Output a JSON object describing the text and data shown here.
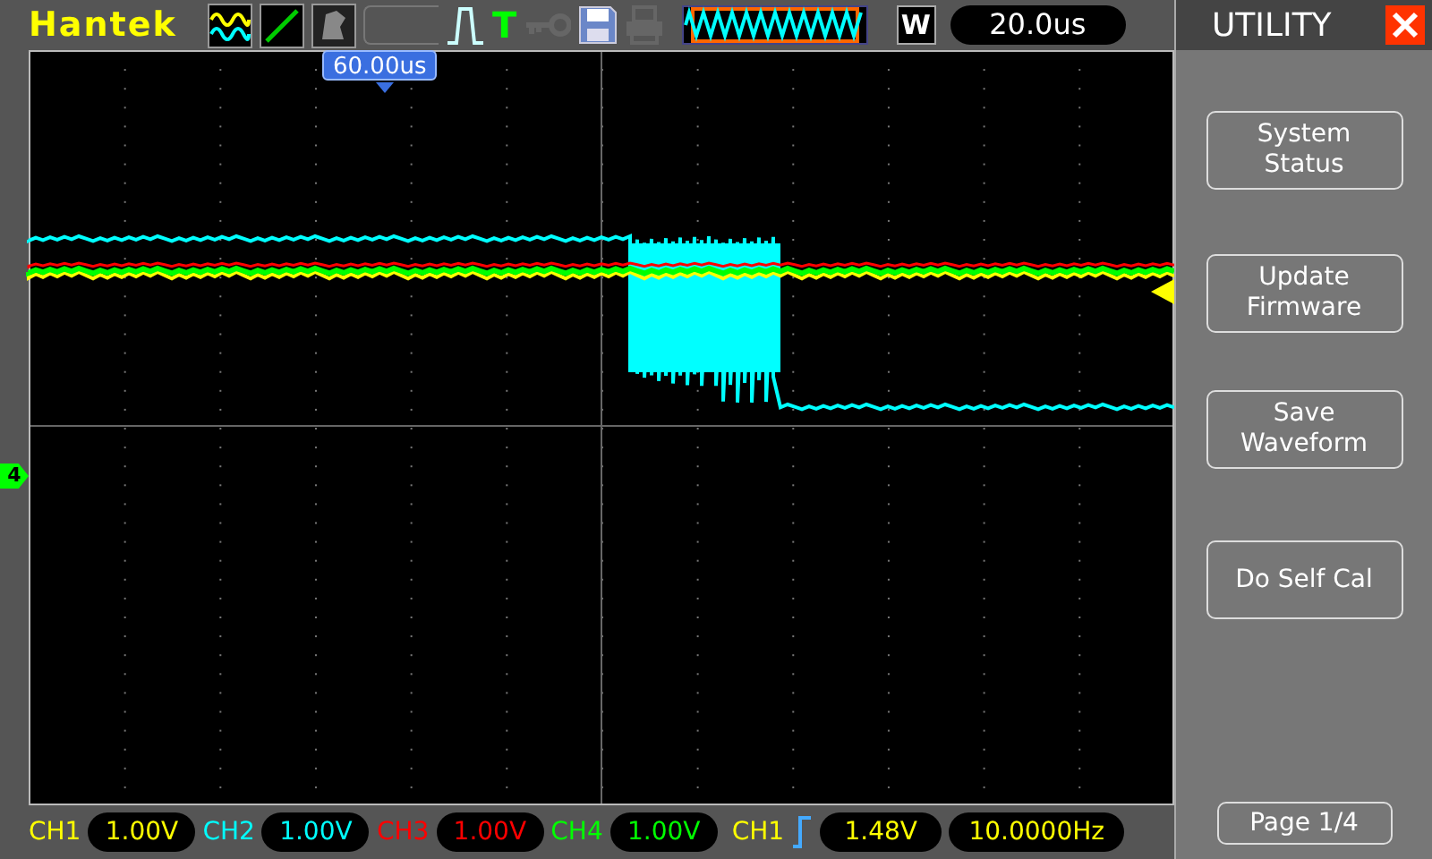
{
  "brand": "Hantek",
  "toolbar": {
    "trigger_letter": "T",
    "timebase_mode": "W",
    "timebase": "20.0us"
  },
  "trigger_position": "60.00us",
  "ground_marker": "4",
  "panel": {
    "title": "UTILITY",
    "menu": [
      {
        "label": "System Status"
      },
      {
        "label": "Update Firmware"
      },
      {
        "label": "Save Waveform"
      },
      {
        "label": "Do Self Cal"
      }
    ],
    "page": "Page 1/4"
  },
  "channels": [
    {
      "name": "CH1",
      "scale": "1.00V",
      "color": "#ffff00"
    },
    {
      "name": "CH2",
      "scale": "1.00V",
      "color": "#00ffff"
    },
    {
      "name": "CH3",
      "scale": "1.00V",
      "color": "#ff0000"
    },
    {
      "name": "CH4",
      "scale": "1.00V",
      "color": "#00ff00"
    }
  ],
  "trigger": {
    "source": "CH1",
    "level": "1.48V",
    "frequency": "10.0000Hz"
  }
}
